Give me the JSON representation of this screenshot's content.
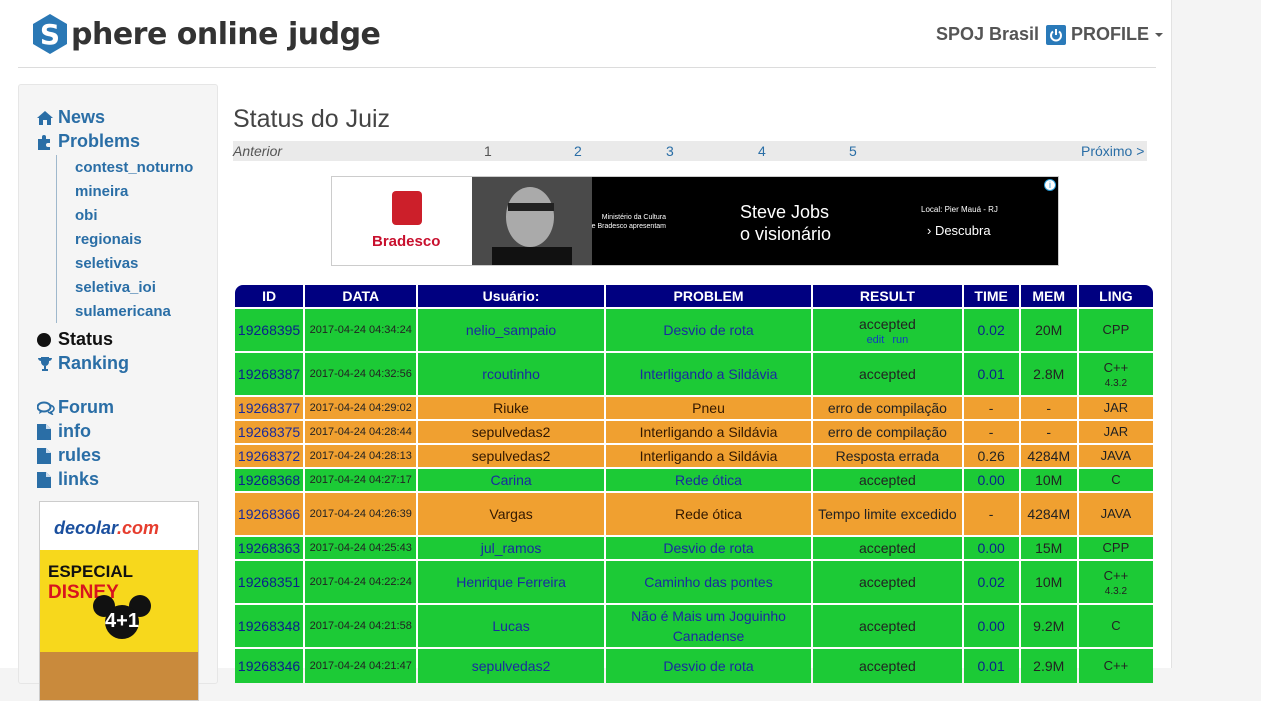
{
  "header": {
    "logo_letter": "S",
    "logo_text": "phere online judge",
    "brand_link": "SPOJ Brasil",
    "profile_label": "PROFILE"
  },
  "sidebar": {
    "main_items": [
      {
        "label": "News",
        "icon": "home-icon"
      },
      {
        "label": "Problems",
        "icon": "puzzle-icon"
      }
    ],
    "sub_items": [
      "contest_noturno",
      "mineira",
      "obi",
      "regionais",
      "seletivas",
      "seletiva_ioi",
      "sulamericana"
    ],
    "lower_items": [
      {
        "label": "Status",
        "icon": "circle-icon"
      },
      {
        "label": "Ranking",
        "icon": "trophy-icon"
      }
    ],
    "extra_items": [
      {
        "label": "Forum",
        "icon": "comments-icon"
      },
      {
        "label": "info",
        "icon": "file-icon"
      },
      {
        "label": "rules",
        "icon": "file-icon"
      },
      {
        "label": "links",
        "icon": "file-icon"
      }
    ],
    "ad": {
      "brand": "decolar",
      "brand_suffix": ".com",
      "headline": "ESPECIAL",
      "headline2": "DISNEY",
      "promo": "4+1"
    }
  },
  "main": {
    "title": "Status do Juiz",
    "pager": {
      "prev": "Anterior",
      "pages": [
        "1",
        "2",
        "3",
        "4",
        "5"
      ],
      "next": "Próximo >"
    },
    "banner": {
      "bank": "Bradesco",
      "small_text_1": "Ministério da Cultura",
      "small_text_2": "e Bradesco apresentam",
      "title_1": "Steve Jobs",
      "title_2": "o visionário",
      "location": "Local: Pier Mauá - RJ",
      "cta": "› Descubra"
    },
    "table": {
      "headers": [
        "ID",
        "DATA",
        "Usuário:",
        "PROBLEM",
        "RESULT",
        "TIME",
        "MEM",
        "LING"
      ],
      "rows": [
        {
          "id": "19268395",
          "date": "2017-04-24 04:34:24",
          "user": "nelio_sampaio",
          "problem": "Desvio de rota",
          "result": "accepted",
          "links": [
            "edit",
            "run"
          ],
          "time": "0.02",
          "mem": "20M",
          "lang": "CPP",
          "lang_ver": "",
          "status": "ok"
        },
        {
          "id": "19268387",
          "date": "2017-04-24 04:32:56",
          "user": "rcoutinho",
          "problem": "Interligando a Sildávia",
          "result": "accepted",
          "links": [],
          "time": "0.01",
          "mem": "2.8M",
          "lang": "C++",
          "lang_ver": "4.3.2",
          "status": "ok"
        },
        {
          "id": "19268377",
          "date": "2017-04-24 04:29:02",
          "user": "Riuke",
          "problem": "Pneu",
          "result": "erro de compilação",
          "links": [],
          "time": "-",
          "mem": "-",
          "lang": "JAR",
          "lang_ver": "",
          "status": "ko"
        },
        {
          "id": "19268375",
          "date": "2017-04-24 04:28:44",
          "user": "sepulvedas2",
          "problem": "Interligando a Sildávia",
          "result": "erro de compilação",
          "links": [],
          "time": "-",
          "mem": "-",
          "lang": "JAR",
          "lang_ver": "",
          "status": "ko"
        },
        {
          "id": "19268372",
          "date": "2017-04-24 04:28:13",
          "user": "sepulvedas2",
          "problem": "Interligando a Sildávia",
          "result": "Resposta errada",
          "links": [],
          "time": "0.26",
          "mem": "4284M",
          "lang": "JAVA",
          "lang_ver": "",
          "status": "ko"
        },
        {
          "id": "19268368",
          "date": "2017-04-24 04:27:17",
          "user": "Carina",
          "problem": "Rede ótica",
          "result": "accepted",
          "links": [],
          "time": "0.00",
          "mem": "10M",
          "lang": "C",
          "lang_ver": "",
          "status": "ok"
        },
        {
          "id": "19268366",
          "date": "2017-04-24 04:26:39",
          "user": "Vargas",
          "problem": "Rede ótica",
          "result": "Tempo limite excedido",
          "links": [],
          "time": "-",
          "mem": "4284M",
          "lang": "JAVA",
          "lang_ver": "",
          "status": "ko"
        },
        {
          "id": "19268363",
          "date": "2017-04-24 04:25:43",
          "user": "jul_ramos",
          "problem": "Desvio de rota",
          "result": "accepted",
          "links": [],
          "time": "0.00",
          "mem": "15M",
          "lang": "CPP",
          "lang_ver": "",
          "status": "ok"
        },
        {
          "id": "19268351",
          "date": "2017-04-24 04:22:24",
          "user": "Henrique Ferreira",
          "problem": "Caminho das pontes",
          "result": "accepted",
          "links": [],
          "time": "0.02",
          "mem": "10M",
          "lang": "C++",
          "lang_ver": "4.3.2",
          "status": "ok"
        },
        {
          "id": "19268348",
          "date": "2017-04-24 04:21:58",
          "user": "Lucas",
          "problem": "Não é Mais um Joguinho Canadense",
          "result": "accepted",
          "links": [],
          "time": "0.00",
          "mem": "9.2M",
          "lang": "C",
          "lang_ver": "",
          "status": "ok"
        },
        {
          "id": "19268346",
          "date": "2017-04-24 04:21:47",
          "user": "sepulvedas2",
          "problem": "Desvio de rota",
          "result": "accepted",
          "links": [],
          "time": "0.01",
          "mem": "2.9M",
          "lang": "C++",
          "lang_ver": "",
          "status": "ok"
        }
      ]
    }
  },
  "colors": {
    "accepted": "#1cca36",
    "error": "#f0a030",
    "header": "#000080",
    "link": "#2a6ea6"
  }
}
